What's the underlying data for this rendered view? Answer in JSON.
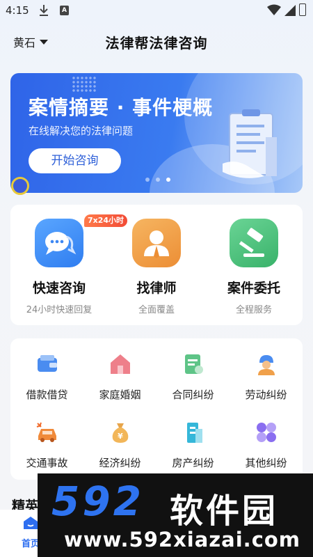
{
  "status_bar": {
    "time": "4:15",
    "a_icon": "A"
  },
  "header": {
    "city": "黄石",
    "title": "法律帮法律咨询"
  },
  "banner": {
    "title": "案情摘要 · 事件梗概",
    "subtitle": "在线解决您的法律问题",
    "button_label": "开始咨询"
  },
  "services": [
    {
      "name": "快速咨询",
      "desc": "24小时快速回复",
      "badge": "7x24小时",
      "icon": "chat-bubbles-icon",
      "color": "#3f8cf5"
    },
    {
      "name": "找律师",
      "desc": "全面覆盖",
      "icon": "lawyer-icon",
      "color": "#f0a04a"
    },
    {
      "name": "案件委托",
      "desc": "全程服务",
      "icon": "gavel-icon",
      "color": "#4cbf7c"
    }
  ],
  "categories": [
    {
      "name": "借款借贷",
      "icon": "wallet-icon"
    },
    {
      "name": "家庭婚姻",
      "icon": "house-icon"
    },
    {
      "name": "合同纠纷",
      "icon": "contract-icon"
    },
    {
      "name": "劳动纠纷",
      "icon": "worker-icon"
    },
    {
      "name": "交通事故",
      "icon": "car-crash-icon"
    },
    {
      "name": "经济纠纷",
      "icon": "money-bag-icon"
    },
    {
      "name": "房产纠纷",
      "icon": "building-icon"
    },
    {
      "name": "其他纠纷",
      "icon": "grid-icon"
    }
  ],
  "section": {
    "title": "精英律师"
  },
  "tabbar": {
    "home_label": "首页"
  },
  "watermark": {
    "number": "592",
    "cn": "软件园",
    "url": "www.592xiazai.com"
  }
}
